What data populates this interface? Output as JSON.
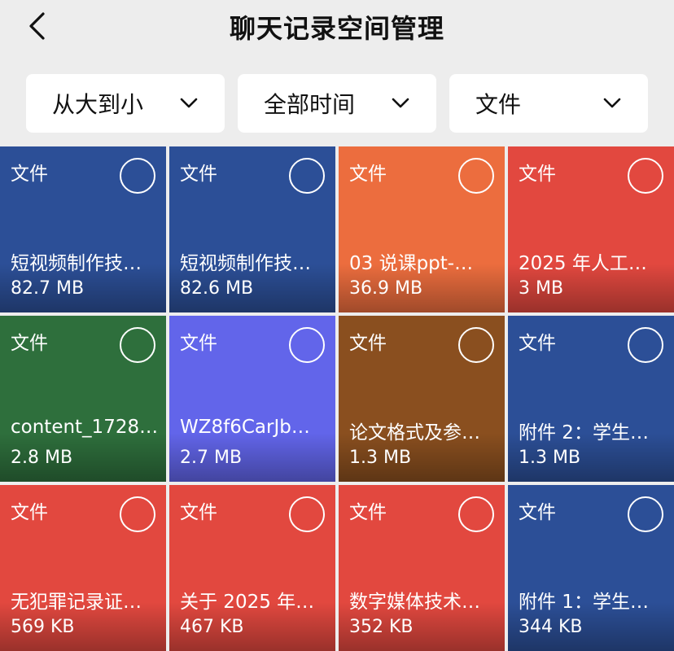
{
  "header": {
    "title": "聊天记录空间管理",
    "back_icon": "chevron-left-icon"
  },
  "filters": [
    {
      "label": "从大到小",
      "icon": "chevron-down-icon"
    },
    {
      "label": "全部时间",
      "icon": "chevron-down-icon"
    },
    {
      "label": "文件",
      "icon": "chevron-down-icon"
    }
  ],
  "tiles": [
    {
      "type": "文件",
      "name": "短视频制作技…",
      "size": "82.7 MB",
      "color": "#2c4f97"
    },
    {
      "type": "文件",
      "name": "短视频制作技…",
      "size": "82.6 MB",
      "color": "#2c4f97"
    },
    {
      "type": "文件",
      "name": "03 说课ppt-…",
      "size": "36.9 MB",
      "color": "#ec6d3e"
    },
    {
      "type": "文件",
      "name": "2025 年人工…",
      "size": "3 MB",
      "color": "#e2483f"
    },
    {
      "type": "文件",
      "name": "content_1728…",
      "size": "2.8 MB",
      "color": "#2e6f3c"
    },
    {
      "type": "文件",
      "name": "WZ8f6CarJb…",
      "size": "2.7 MB",
      "color": "#6265ea"
    },
    {
      "type": "文件",
      "name": "论文格式及参…",
      "size": "1.3 MB",
      "color": "#8a4f1f"
    },
    {
      "type": "文件",
      "name": "附件 2：学生…",
      "size": "1.3 MB",
      "color": "#2c4f97"
    },
    {
      "type": "文件",
      "name": "无犯罪记录证…",
      "size": "569 KB",
      "color": "#e2483f"
    },
    {
      "type": "文件",
      "name": "关于 2025 年…",
      "size": "467 KB",
      "color": "#e2483f"
    },
    {
      "type": "文件",
      "name": "数字媒体技术…",
      "size": "352 KB",
      "color": "#e2483f"
    },
    {
      "type": "文件",
      "name": "附件 1：学生…",
      "size": "344 KB",
      "color": "#2c4f97"
    }
  ]
}
